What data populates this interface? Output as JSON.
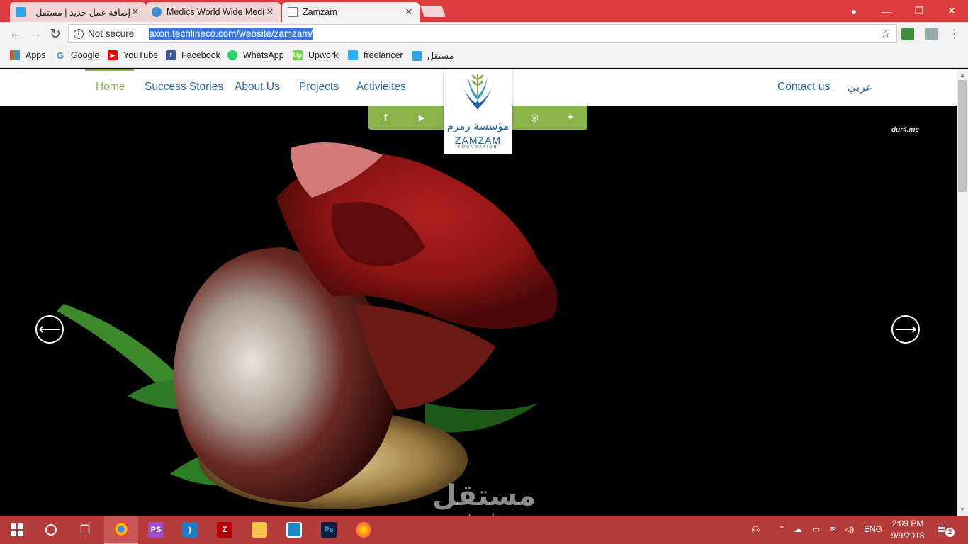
{
  "browser": {
    "tabs": [
      {
        "title": "إضافة عمل جديد | مستقل",
        "active": false
      },
      {
        "title": "Medics World Wide Medi",
        "active": false
      },
      {
        "title": "Zamzam",
        "active": true
      }
    ],
    "address": {
      "security": "Not secure",
      "url": "axon.techlineco.com/website/zamzam/"
    },
    "bookmarks": [
      "Apps",
      "Google",
      "YouTube",
      "Facebook",
      "WhatsApp",
      "Upwork",
      "freelancer",
      "مستقل"
    ]
  },
  "site": {
    "nav": {
      "home": "Home",
      "success": "Success Stories",
      "about": "About Us",
      "projects": "Projects",
      "activities": "Activieites",
      "contact": "Contact us",
      "arabic": "عربي"
    },
    "logo": {
      "arabic": "مؤسسة زمزم",
      "english": "ZAMZAM",
      "foundation": "FOUNDATION"
    },
    "social": [
      "facebook-icon",
      "youtube-icon",
      "instagram-icon",
      "twitter-icon"
    ],
    "hero_watermark": "dur4.me",
    "colors": {
      "nav": "#2c67a6",
      "accent": "#8ab24b"
    }
  },
  "watermark": {
    "arabic": "مستقل",
    "latin": "mostaql.com"
  },
  "taskbar": {
    "lang": "ENG",
    "time": "2:09 PM",
    "date": "9/9/2018",
    "notifications": "2"
  }
}
